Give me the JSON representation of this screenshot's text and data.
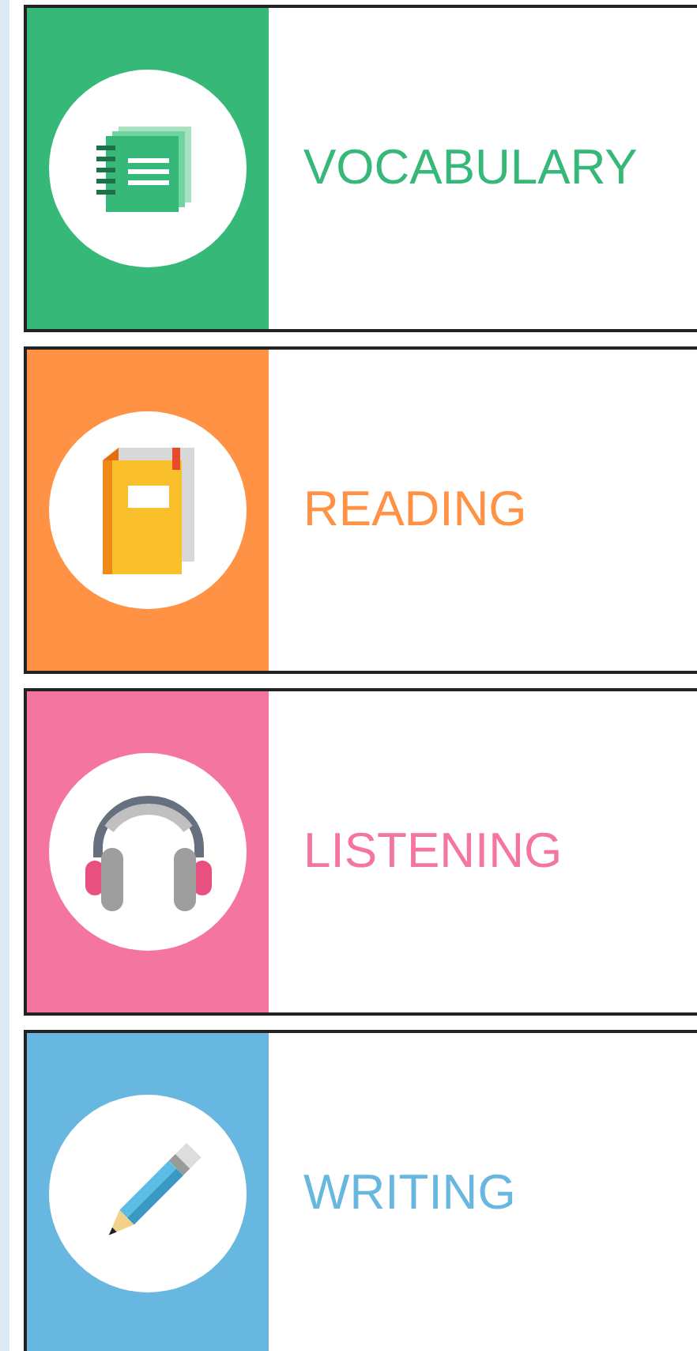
{
  "sections": [
    {
      "label": "VOCABULARY",
      "kind": "cards",
      "color": "#36b978"
    },
    {
      "label": "READING",
      "kind": "book",
      "color": "#ff9245"
    },
    {
      "label": "LISTENING",
      "kind": "headphones",
      "color": "#f476a0"
    },
    {
      "label": "WRITING",
      "kind": "pencil",
      "color": "#67b7e1"
    }
  ]
}
